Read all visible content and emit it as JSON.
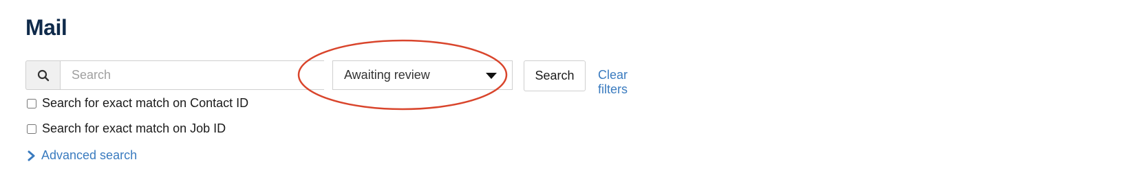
{
  "page": {
    "title": "Mail"
  },
  "filters": {
    "search_placeholder": "Search",
    "search_value": "",
    "status_selected": "Awaiting review",
    "search_button_label": "Search",
    "clear_filters_label": "Clear filters"
  },
  "options": [
    {
      "label": "Search for exact match on Contact ID",
      "checked": false
    },
    {
      "label": "Search for exact match on Job ID",
      "checked": false
    }
  ],
  "advanced_search_label": "Advanced search",
  "icons": {
    "search": "search-icon",
    "dropdown": "caret-down-icon",
    "advanced": "chevron-right-icon"
  },
  "colors": {
    "title": "#0f2a4a",
    "link": "#3a7bbf",
    "annotation": "#d9452c"
  }
}
